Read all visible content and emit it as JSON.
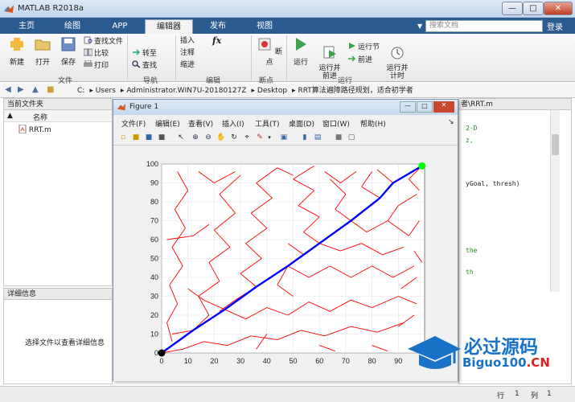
{
  "window": {
    "title": "MATLAB R2018a",
    "min": "—",
    "max": "□",
    "close": "✕"
  },
  "tabs": [
    "主页",
    "绘图",
    "APP",
    "编辑器",
    "发布",
    "视图"
  ],
  "search": {
    "placeholder": "搜索文档",
    "dropdown": "▼"
  },
  "login": "登录",
  "ribbon": {
    "file": {
      "new": "新建",
      "open": "打开",
      "save": "保存",
      "find_files": "查找文件",
      "compare": "比较",
      "print": "打印",
      "group": "文件"
    },
    "nav": {
      "goto": "转至",
      "find": "查找",
      "group": "导航"
    },
    "edit": {
      "insert": "插入",
      "comment": "注释",
      "indent": "缩进",
      "fx": "fx",
      "group": "编辑"
    },
    "breakpoints": {
      "label": "断点",
      "group": "断点"
    },
    "run": {
      "run": "运行",
      "run_advance": "运行并\n前进",
      "run_section": "运行节",
      "advance": "前进",
      "run_time": "运行并\n计时",
      "group": "运行"
    }
  },
  "path": [
    "C:",
    "Users",
    "Administrator.WIN7U-20180127Z",
    "Desktop",
    "RRT算法遍障路径规划，适合初学者"
  ],
  "file_panel": {
    "title": "当前文件夹",
    "col_name": "名称",
    "sort": "▲",
    "file": "RRT.m"
  },
  "detail_panel": {
    "title": "详细信息",
    "message": "选择文件以查看详细信息"
  },
  "editor": {
    "title": "者\\RRT.m",
    "lines": [
      "2-D",
      "z,",
      "",
      "",
      "yGoal, thresh)",
      "",
      "",
      "",
      "",
      "the",
      "",
      "th"
    ]
  },
  "status": {
    "row_label": "行",
    "row": "1",
    "col_label": "列",
    "col": "1"
  },
  "figure": {
    "title": "Figure 1",
    "menu": [
      "文件(F)",
      "编辑(E)",
      "查看(V)",
      "插入(I)",
      "工具(T)",
      "桌面(D)",
      "窗口(W)",
      "帮助(H)"
    ]
  },
  "watermark": {
    "cn": "必过源码",
    "en_main": "Biguo100",
    "en_suffix": ".CN"
  },
  "colors": {
    "tree": "#ff0000",
    "path": "#0000ff",
    "goal": "#00ff00",
    "start": "#000000"
  },
  "chart_data": {
    "type": "line",
    "xlim": [
      0,
      100
    ],
    "ylim": [
      0,
      100
    ],
    "xticks": [
      0,
      10,
      20,
      30,
      40,
      50,
      60,
      70,
      80,
      90
    ],
    "yticks": [
      0,
      10,
      20,
      30,
      40,
      50,
      60,
      70,
      80,
      90,
      100
    ],
    "grid": true,
    "start": [
      0,
      0
    ],
    "goal": [
      99,
      99
    ],
    "path": {
      "x": [
        0,
        12,
        24,
        36,
        48,
        60,
        72,
        83,
        88,
        99
      ],
      "y": [
        0,
        12,
        23,
        35,
        46,
        58,
        70,
        82,
        90,
        99
      ]
    },
    "tree_edges": [
      [
        0,
        0,
        8,
        2
      ],
      [
        8,
        2,
        16,
        6
      ],
      [
        16,
        6,
        25,
        4
      ],
      [
        25,
        4,
        34,
        9
      ],
      [
        34,
        9,
        44,
        7
      ],
      [
        44,
        7,
        53,
        12
      ],
      [
        53,
        12,
        62,
        9
      ],
      [
        62,
        9,
        72,
        14
      ],
      [
        72,
        14,
        82,
        11
      ],
      [
        82,
        11,
        92,
        16
      ],
      [
        4,
        6,
        2,
        16
      ],
      [
        2,
        16,
        6,
        26
      ],
      [
        6,
        26,
        3,
        36
      ],
      [
        3,
        36,
        8,
        46
      ],
      [
        8,
        46,
        4,
        56
      ],
      [
        4,
        56,
        9,
        66
      ],
      [
        9,
        66,
        5,
        76
      ],
      [
        5,
        76,
        10,
        86
      ],
      [
        10,
        86,
        6,
        96
      ],
      [
        12,
        12,
        18,
        20
      ],
      [
        18,
        20,
        14,
        30
      ],
      [
        14,
        30,
        22,
        38
      ],
      [
        22,
        38,
        18,
        48
      ],
      [
        18,
        48,
        26,
        56
      ],
      [
        26,
        56,
        20,
        65
      ],
      [
        20,
        65,
        28,
        74
      ],
      [
        28,
        74,
        22,
        84
      ],
      [
        22,
        84,
        30,
        94
      ],
      [
        24,
        23,
        32,
        18
      ],
      [
        32,
        18,
        40,
        24
      ],
      [
        40,
        24,
        48,
        20
      ],
      [
        48,
        20,
        56,
        27
      ],
      [
        56,
        27,
        64,
        22
      ],
      [
        64,
        22,
        72,
        28
      ],
      [
        72,
        28,
        80,
        24
      ],
      [
        80,
        24,
        90,
        30
      ],
      [
        90,
        30,
        97,
        26
      ],
      [
        36,
        35,
        30,
        42
      ],
      [
        30,
        42,
        38,
        50
      ],
      [
        38,
        50,
        32,
        58
      ],
      [
        32,
        58,
        40,
        66
      ],
      [
        40,
        66,
        34,
        74
      ],
      [
        34,
        74,
        42,
        82
      ],
      [
        42,
        82,
        36,
        90
      ],
      [
        36,
        90,
        44,
        98
      ],
      [
        48,
        46,
        56,
        40
      ],
      [
        56,
        40,
        64,
        46
      ],
      [
        64,
        46,
        72,
        40
      ],
      [
        72,
        40,
        80,
        46
      ],
      [
        80,
        46,
        88,
        40
      ],
      [
        88,
        40,
        96,
        46
      ],
      [
        60,
        58,
        54,
        64
      ],
      [
        54,
        64,
        60,
        72
      ],
      [
        60,
        72,
        52,
        78
      ],
      [
        52,
        78,
        58,
        86
      ],
      [
        58,
        86,
        50,
        92
      ],
      [
        50,
        92,
        58,
        99
      ],
      [
        72,
        70,
        78,
        64
      ],
      [
        78,
        64,
        86,
        70
      ],
      [
        86,
        70,
        94,
        62
      ],
      [
        94,
        62,
        98,
        70
      ],
      [
        86,
        70,
        90,
        78
      ],
      [
        90,
        78,
        97,
        84
      ],
      [
        48,
        46,
        44,
        36
      ],
      [
        44,
        36,
        50,
        30
      ],
      [
        36,
        35,
        28,
        28
      ],
      [
        28,
        28,
        22,
        22
      ],
      [
        60,
        58,
        68,
        54
      ],
      [
        68,
        54,
        76,
        58
      ],
      [
        76,
        58,
        84,
        52
      ],
      [
        84,
        52,
        92,
        56
      ],
      [
        12,
        12,
        4,
        10
      ],
      [
        24,
        23,
        16,
        28
      ],
      [
        16,
        28,
        10,
        34
      ],
      [
        48,
        46,
        54,
        52
      ],
      [
        54,
        52,
        48,
        58
      ],
      [
        72,
        70,
        66,
        76
      ],
      [
        66,
        76,
        70,
        84
      ],
      [
        70,
        84,
        64,
        92
      ],
      [
        83,
        82,
        76,
        88
      ],
      [
        76,
        88,
        80,
        96
      ],
      [
        88,
        90,
        82,
        97
      ],
      [
        99,
        99,
        94,
        92
      ],
      [
        94,
        92,
        98,
        86
      ],
      [
        14,
        96,
        20,
        90
      ],
      [
        20,
        90,
        28,
        96
      ],
      [
        44,
        98,
        50,
        94
      ],
      [
        62,
        96,
        68,
        90
      ],
      [
        68,
        90,
        74,
        96
      ],
      [
        96,
        20,
        90,
        14
      ],
      [
        97,
        40,
        91,
        34
      ],
      [
        96,
        54,
        99,
        48
      ],
      [
        2,
        60,
        12,
        62
      ],
      [
        12,
        62,
        18,
        68
      ],
      [
        40,
        10,
        36,
        2
      ],
      [
        60,
        4,
        66,
        1
      ],
      [
        80,
        4,
        86,
        1
      ]
    ]
  }
}
